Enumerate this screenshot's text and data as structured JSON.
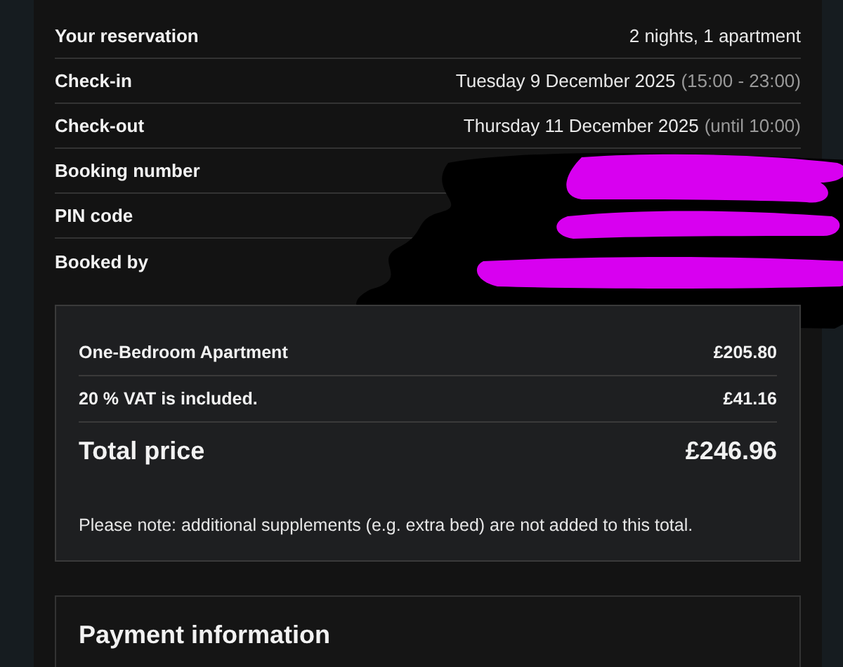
{
  "reservation": [
    {
      "label": "Your reservation",
      "value": "2 nights, 1 apartment"
    },
    {
      "label": "Check-in",
      "value": "Tuesday 9 December 2025",
      "note": "(15:00 - 23:00)"
    },
    {
      "label": "Check-out",
      "value": "Thursday 11 December 2025",
      "note": "(until 10:00)"
    },
    {
      "label": "Booking number"
    },
    {
      "label": "PIN code"
    },
    {
      "label": "Booked by"
    }
  ],
  "price": {
    "lines": [
      {
        "label": "One-Bedroom Apartment",
        "amount": "£205.80"
      },
      {
        "label": "20 % VAT is included.",
        "amount": "£41.16"
      }
    ],
    "total": {
      "label": "Total price",
      "amount": "£246.96"
    },
    "note": "Please note: additional supplements (e.g. extra bed) are not added to this total."
  },
  "payment": {
    "title": "Payment information"
  }
}
